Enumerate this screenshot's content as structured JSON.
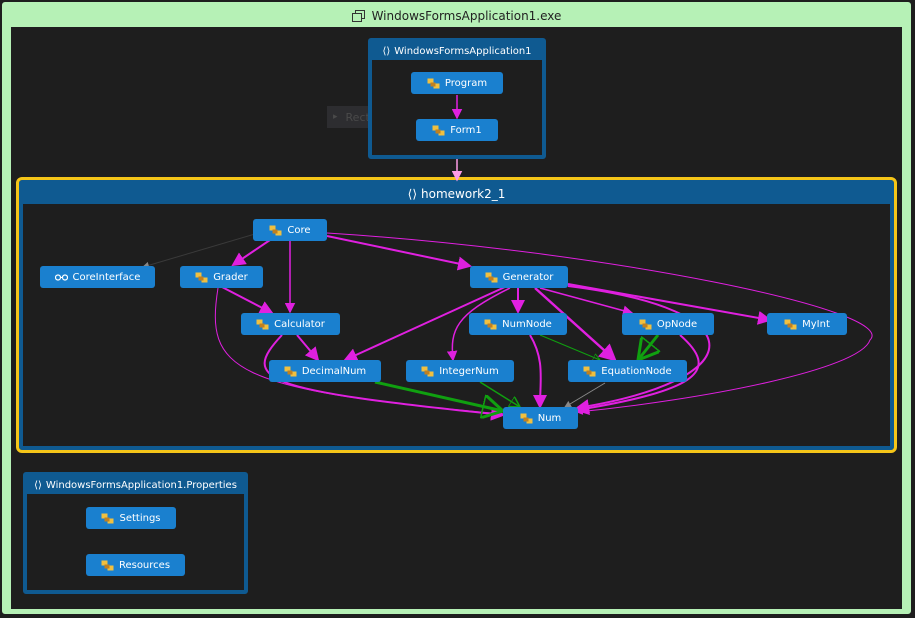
{
  "window": {
    "title": "WindowsFormsApplication1.exe"
  },
  "colors": {
    "outer_border": "#b6f1b6",
    "group": "#0f5a91",
    "selected_group": "#f5c518",
    "node": "#1a80cf",
    "call_edge": "#e020e0",
    "inherit_edge": "#10a010",
    "weak_edge": "#888888"
  },
  "ghost": {
    "label": "RectangleGroup",
    "icon": "expand-icon"
  },
  "groups": {
    "app": {
      "label": "WindowsFormsApplication1",
      "icon": "namespace-icon",
      "nodes": {
        "program": "Program",
        "form1": "Form1"
      }
    },
    "hw": {
      "label": "homework2_1",
      "icon": "namespace-icon",
      "nodes": {
        "core": "Core",
        "coreinterface": "CoreInterface",
        "grader": "Grader",
        "generator": "Generator",
        "calculator": "Calculator",
        "numnode": "NumNode",
        "opnode": "OpNode",
        "myint": "MyInt",
        "decimalnum": "DecimalNum",
        "integernum": "IntegerNum",
        "equationnode": "EquationNode",
        "num": "Num"
      }
    },
    "props": {
      "label": "WindowsFormsApplication1.Properties",
      "icon": "namespace-icon",
      "nodes": {
        "settings": "Settings",
        "resources": "Resources"
      }
    }
  }
}
